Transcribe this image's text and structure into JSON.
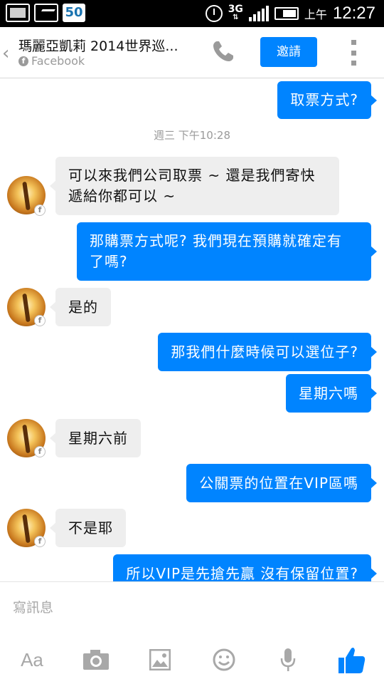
{
  "status_bar": {
    "notification_icons": [
      "gallery-icon",
      "game-icon"
    ],
    "badge_number": "50",
    "network": "3G",
    "ampm": "上午",
    "time": "12:27"
  },
  "header": {
    "title": "瑪麗亞凱莉 2014世界巡...",
    "subtitle": "Facebook",
    "invite_label": "邀請",
    "back_icon": "chevron-left-icon",
    "call_icon": "phone-icon",
    "more_icon": "more-vertical-icon"
  },
  "messages": [
    {
      "from": "me",
      "lines": [
        "取票方式?"
      ]
    },
    {
      "type": "timestamp",
      "text": "週三 下午10:28"
    },
    {
      "from": "them",
      "lines": [
        "可以來我們公司取票 ~ 還是我們寄快",
        "遞給你都可以 ~"
      ]
    },
    {
      "from": "me",
      "lines": [
        "那購票方式呢? 我們現在預購就確定有",
        "了嗎?"
      ]
    },
    {
      "from": "them",
      "lines": [
        "是的"
      ]
    },
    {
      "from": "me",
      "lines": [
        "那我們什麼時候可以選位子?"
      ]
    },
    {
      "from": "me",
      "lines": [
        "星期六嗎"
      ]
    },
    {
      "from": "them",
      "lines": [
        "星期六前"
      ]
    },
    {
      "from": "me",
      "lines": [
        "公關票的位置在VIP區嗎"
      ]
    },
    {
      "from": "them",
      "lines": [
        "不是耶"
      ]
    },
    {
      "from": "me",
      "lines": [
        "所以VIP是先搶先贏 沒有保留位置?"
      ]
    }
  ],
  "composer": {
    "placeholder": "寫訊息",
    "text_format_label": "Aa",
    "tools": [
      "camera-icon",
      "image-icon",
      "emoji-icon",
      "microphone-icon",
      "thumbs-up-icon"
    ]
  },
  "colors": {
    "accent": "#0084ff",
    "incoming_bubble": "#eeeeee",
    "muted_text": "#9a9a9a"
  }
}
